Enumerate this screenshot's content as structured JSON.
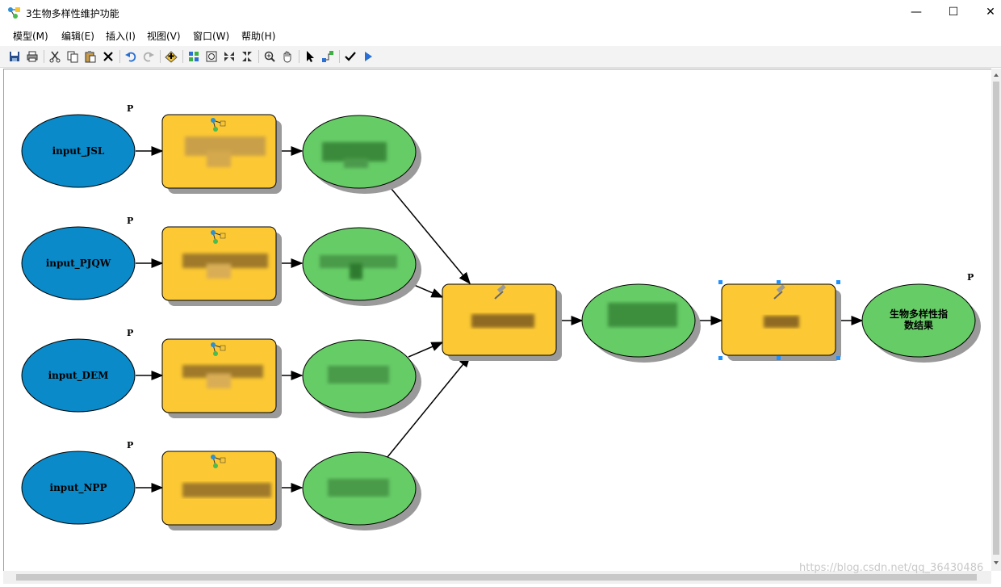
{
  "window": {
    "title": "3生物多样性维护功能",
    "minimize": "—",
    "maximize": "☐",
    "close": "✕"
  },
  "menu": [
    "模型(M)",
    "编辑(E)",
    "插入(I)",
    "视图(V)",
    "窗口(W)",
    "帮助(H)"
  ],
  "toolbar": [
    "save-icon",
    "print-icon",
    "cut-icon",
    "copy-icon",
    "paste-icon",
    "delete-icon",
    "undo-icon",
    "redo-icon",
    "add-data-icon",
    "auto-layout-icon",
    "full-extent-icon",
    "fixed-zoom-in-icon",
    "fixed-zoom-out-icon",
    "zoom-in-icon",
    "pan-icon",
    "select-icon",
    "connect-icon",
    "validate-icon",
    "run-icon"
  ],
  "colors": {
    "input": "#0a8ac9",
    "tool": "#fcc934",
    "output": "#66cc66",
    "shadow": "#9a9a9a",
    "selection": "#1e90ff"
  },
  "model": {
    "inputs": [
      "input_JSL",
      "input_PJQW",
      "input_DEM",
      "input_NPP"
    ],
    "p_marker": "P",
    "final_output": [
      "生物多样性指",
      "数结果"
    ]
  },
  "watermark": "https://blog.csdn.net/qq_36430486"
}
